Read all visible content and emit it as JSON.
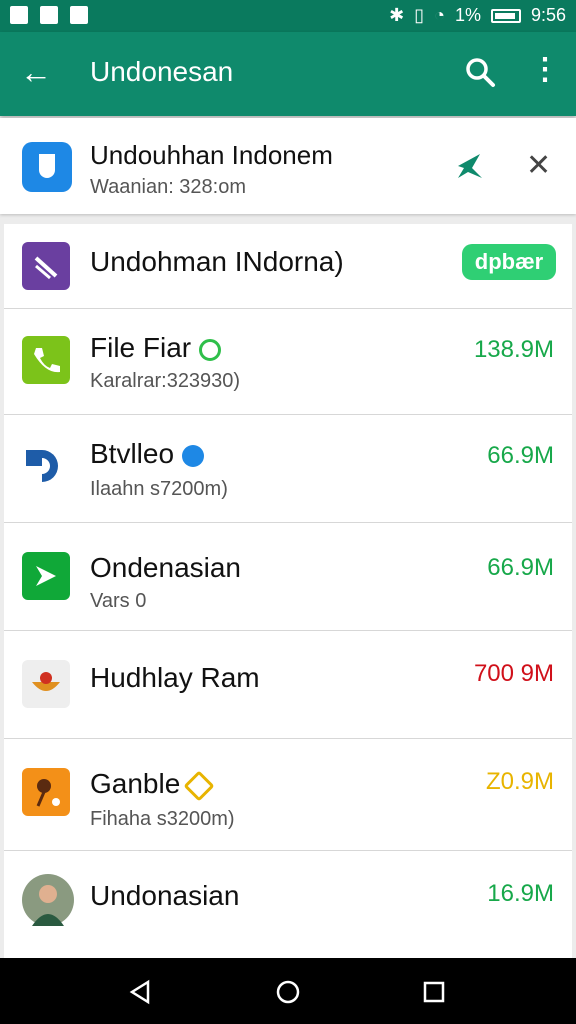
{
  "statusbar": {
    "battery_pct": "1%",
    "time": "9:56"
  },
  "appbar": {
    "title": "Undonesan"
  },
  "banner": {
    "name": "Undouhhan Indonem",
    "sub": "Waanian: 328:om"
  },
  "rows": [
    {
      "name": "Undohman INdorna)",
      "badge": "dpbær"
    },
    {
      "name": "File Fiar",
      "sub": "Karalrar:323930)",
      "value": "138.9M",
      "value_color": "#17a84a"
    },
    {
      "name": "Btvlleo",
      "sub": "Ilaahn s7200m)",
      "value": "66.9M",
      "value_color": "#17a84a"
    },
    {
      "name": "Ondenasian",
      "sub": "Vars 0",
      "value": "66.9M",
      "value_color": "#17a84a"
    },
    {
      "name": "Hudhlay Ram",
      "sub": "",
      "value": "700 9M",
      "value_color": "#d0101a"
    },
    {
      "name": "Ganble",
      "sub": "Fihaha s3200m)",
      "value": "Z0.9M",
      "value_color": "#e8b400"
    },
    {
      "name": "Undonasian",
      "sub": "",
      "value": "16.9M",
      "value_color": "#17a84a"
    }
  ],
  "colors": {
    "appbar": "#0f8a6c",
    "status": "#0a7a5e",
    "accent_green": "#2fcf74"
  }
}
